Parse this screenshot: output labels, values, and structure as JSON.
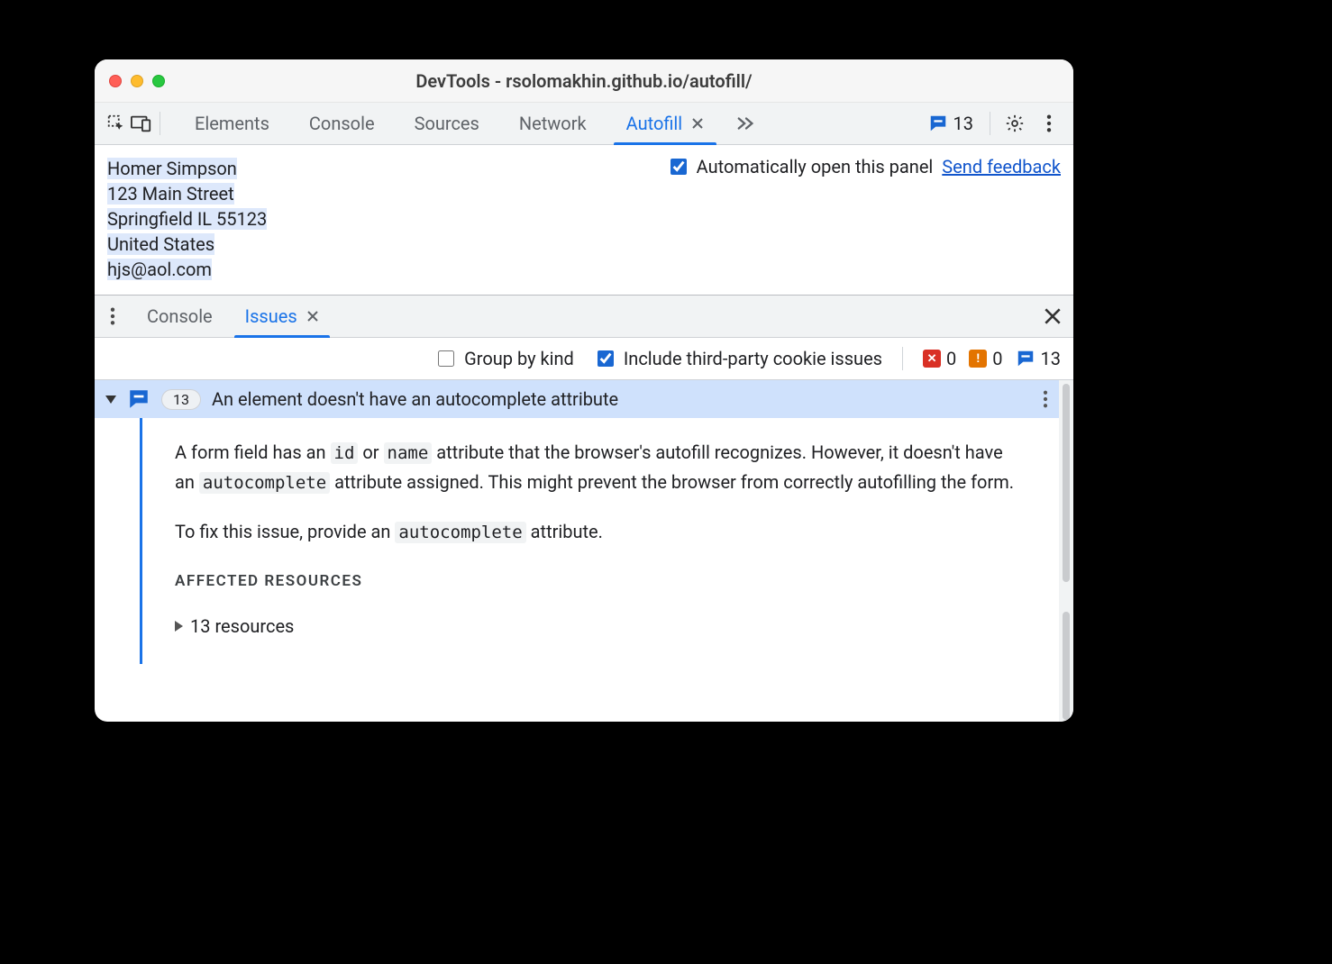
{
  "window_title": "DevTools - rsolomakhin.github.io/autofill/",
  "toolbar": {
    "tabs": [
      "Elements",
      "Console",
      "Sources",
      "Network",
      "Autofill"
    ],
    "active_tab": "Autofill",
    "issue_count": "13"
  },
  "panel": {
    "auto_open_label": "Automatically open this panel",
    "auto_open_checked": true,
    "feedback_label": "Send feedback",
    "address_lines": [
      "Homer Simpson",
      "123 Main Street",
      "Springfield IL 55123",
      "United States",
      "hjs@aol.com"
    ]
  },
  "drawer": {
    "tabs": [
      "Console",
      "Issues"
    ],
    "active_tab": "Issues"
  },
  "filters": {
    "group_by_kind_label": "Group by kind",
    "group_by_kind_checked": false,
    "include_3p_label": "Include third-party cookie issues",
    "include_3p_checked": true,
    "counts": {
      "errors": "0",
      "warnings": "0",
      "info": "13"
    }
  },
  "issue": {
    "count_pill": "13",
    "title": "An element doesn't have an autocomplete attribute",
    "para1_pre": "A form field has an ",
    "code_id": "id",
    "para1_mid": " or ",
    "code_name": "name",
    "para1_post": " attribute that the browser's autofill recognizes. However, it doesn't have an ",
    "code_ac1": "autocomplete",
    "para1_tail": " attribute assigned. This might prevent the browser from correctly autofilling the form.",
    "para2_pre": "To fix this issue, provide an ",
    "code_ac2": "autocomplete",
    "para2_tail": " attribute.",
    "affected_title": "AFFECTED RESOURCES",
    "resources_label": "13 resources"
  }
}
